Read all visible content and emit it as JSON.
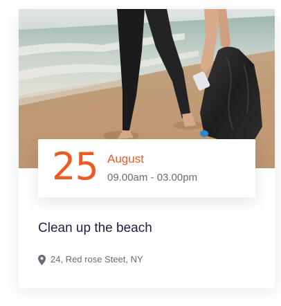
{
  "event": {
    "day": "25",
    "month": "August",
    "time": "09.00am - 03.00pm",
    "title": "Clean up the beach",
    "address": "24, Red rose Steet, NY"
  },
  "icons": {
    "location": "map-pin-icon"
  },
  "colors": {
    "accent": "#ee5a24",
    "title": "#1e1e46",
    "muted": "#6b6b75"
  }
}
